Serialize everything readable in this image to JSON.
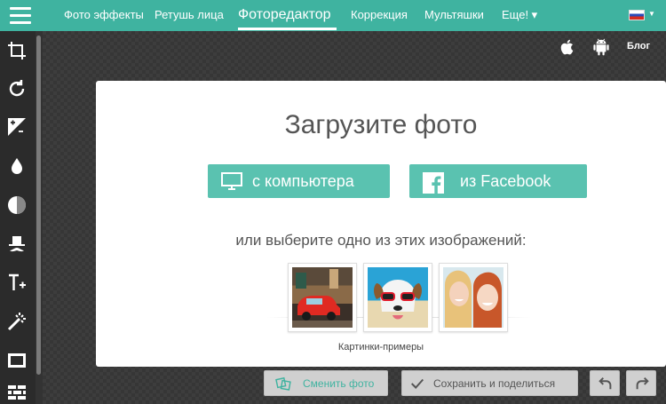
{
  "nav": {
    "items": [
      {
        "label": "Фото эффекты"
      },
      {
        "label": "Ретушь лица"
      },
      {
        "label": "Фоторедактор",
        "active": true
      },
      {
        "label": "Коррекция"
      },
      {
        "label": "Мультяшки"
      },
      {
        "label": "Еще! ▾"
      }
    ],
    "accent_color": "#3fb3a0"
  },
  "header_right": {
    "blog_label": "Блог",
    "icons": [
      "apple-icon",
      "android-icon"
    ]
  },
  "toolbar": {
    "tools": [
      "crop-icon",
      "rotate-icon",
      "exposure-icon",
      "drop-icon",
      "contrast-icon",
      "hat-mustache-icon",
      "text-icon",
      "magic-wand-icon",
      "frame-icon",
      "texture-icon"
    ]
  },
  "upload": {
    "title": "Загрузите фото",
    "from_computer_label": "с компьютера",
    "from_facebook_label": "из Facebook",
    "choose_text": "или выберите одно из этих изображений:",
    "samples_label": "Картинки-примеры",
    "samples": [
      "red-car-photo",
      "dog-sunglasses-photo",
      "girls-selfie-photo"
    ]
  },
  "actions": {
    "change_photo_label": "Сменить фото",
    "save_share_label": "Сохранить и поделиться"
  }
}
